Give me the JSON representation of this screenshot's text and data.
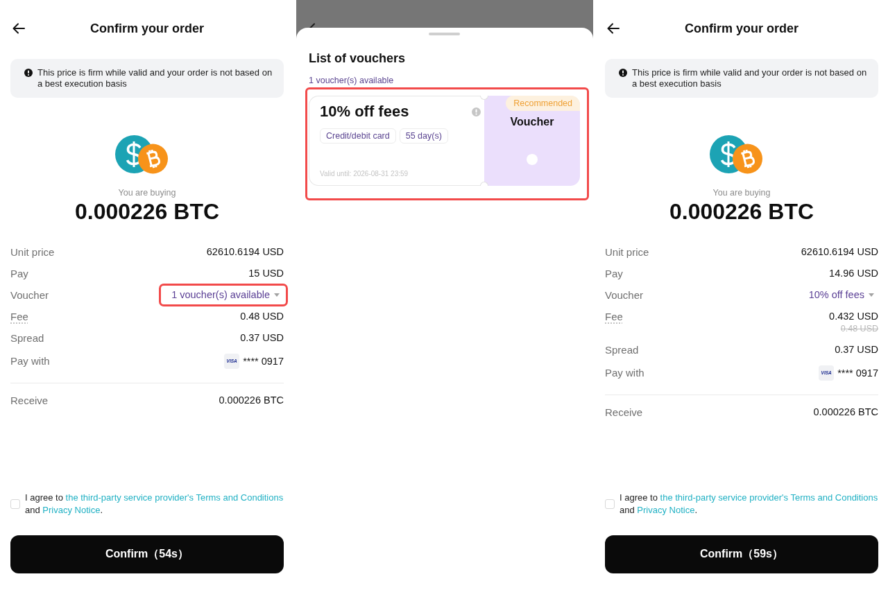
{
  "screens": [
    {
      "kind": "order",
      "header": {
        "title": "Confirm your order"
      },
      "notice": "This price is firm while valid and your order is not based on a best execution basis",
      "buying_label": "You are buying",
      "amount": "0.000226 BTC",
      "details": [
        {
          "kind": "plain",
          "label": "Unit price",
          "value": "62610.6194 USD",
          "highlighted": false
        },
        {
          "kind": "plain",
          "label": "Pay",
          "value": "15 USD",
          "highlighted": false
        },
        {
          "kind": "dropdown",
          "label": "Voucher",
          "value": "1 voucher(s) available",
          "highlighted": true
        },
        {
          "kind": "fee",
          "label": "Fee",
          "value": "0.48 USD",
          "highlighted": false
        },
        {
          "kind": "plain",
          "label": "Spread",
          "value": "0.37 USD",
          "highlighted": false
        },
        {
          "kind": "card",
          "label": "Pay with",
          "brand": "VISA",
          "value": "**** 0917",
          "highlighted": false
        }
      ],
      "receive": {
        "label": "Receive",
        "value": "0.000226 BTC"
      },
      "agreement": {
        "checked": false,
        "parts": [
          {
            "kind": "text",
            "text": "I agree to "
          },
          {
            "kind": "link",
            "text": "the third-party service provider's Terms and Conditions"
          },
          {
            "kind": "text",
            "text": " and "
          },
          {
            "kind": "link",
            "text": "Privacy Notice"
          },
          {
            "kind": "text",
            "text": "."
          }
        ]
      },
      "confirm_button": "Confirm（54s）"
    },
    {
      "kind": "vouchers",
      "sheet": {
        "title": "List of vouchers",
        "count": "1 voucher(s) available",
        "vouchers": [
          {
            "title": "10% off fees",
            "tags": [
              "Credit/debit card",
              "55 day(s)"
            ],
            "valid_until": "Valid until: 2026-08-31 23:59",
            "badge": "Recommended",
            "type": "Voucher",
            "selected": false,
            "highlighted": true
          }
        ]
      }
    },
    {
      "kind": "order",
      "header": {
        "title": "Confirm your order"
      },
      "notice": "This price is firm while valid and your order is not based on a best execution basis",
      "buying_label": "You are buying",
      "amount": "0.000226 BTC",
      "details": [
        {
          "kind": "plain",
          "label": "Unit price",
          "value": "62610.6194 USD",
          "highlighted": false
        },
        {
          "kind": "plain",
          "label": "Pay",
          "value": "14.96 USD",
          "highlighted": false
        },
        {
          "kind": "dropdown",
          "label": "Voucher",
          "value": "10% off fees",
          "highlighted": false
        },
        {
          "kind": "fee",
          "label": "Fee",
          "value": "0.432 USD",
          "old_value": "0.48 USD",
          "highlighted": false
        },
        {
          "kind": "plain",
          "label": "Spread",
          "value": "0.37 USD",
          "highlighted": false
        },
        {
          "kind": "card",
          "label": "Pay with",
          "brand": "VISA",
          "value": "**** 0917",
          "highlighted": false
        }
      ],
      "receive": {
        "label": "Receive",
        "value": "0.000226 BTC"
      },
      "agreement": {
        "checked": false,
        "parts": [
          {
            "kind": "text",
            "text": "I agree to "
          },
          {
            "kind": "link",
            "text": "the third-party service provider's Terms and Conditions"
          },
          {
            "kind": "text",
            "text": " and "
          },
          {
            "kind": "link",
            "text": "Privacy Notice"
          },
          {
            "kind": "text",
            "text": "."
          }
        ]
      },
      "confirm_button": "Confirm（59s）"
    }
  ]
}
